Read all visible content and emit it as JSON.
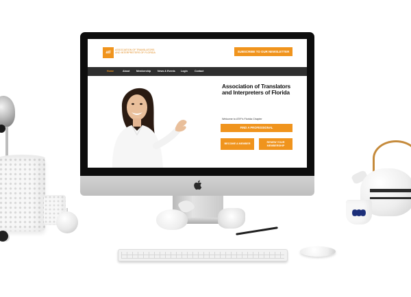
{
  "site": {
    "logo_text": "ati",
    "org_name_line1": "ASSOCIATION OF TRANSLATORS",
    "org_name_line2": "AND INTERPRETERS OF FLORIDA",
    "newsletter_label": "SUBSCRIBE TO OUR NEWSLETTER"
  },
  "nav": {
    "items": [
      {
        "label": "Home",
        "active": true
      },
      {
        "label": "About",
        "active": false
      },
      {
        "label": "Membership",
        "active": false
      },
      {
        "label": "News & Events",
        "active": false
      },
      {
        "label": "Login",
        "active": false
      },
      {
        "label": "Contact",
        "active": false
      }
    ]
  },
  "hero": {
    "title": "Association of Translators and Interpreters of Florida",
    "subtitle": "Welcome to ATIF's Florida Chapter",
    "find_label": "FIND A PROFESSIONAL",
    "become_label": "BECOME A MEMBER",
    "renew_label": "RENEW YOUR MEMBERSHIP"
  },
  "colors": {
    "accent": "#f0941d",
    "navbar": "#2f2f2f"
  },
  "icons": {
    "apple": "apple-logo-icon"
  }
}
